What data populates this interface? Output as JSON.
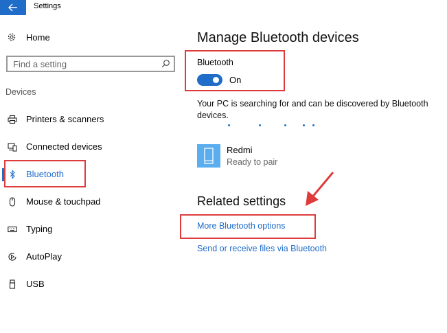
{
  "window": {
    "title": "Settings"
  },
  "sidebar": {
    "home_label": "Home",
    "search_placeholder": "Find a setting",
    "group_label": "Devices",
    "items": [
      {
        "label": "Printers & scanners",
        "icon": "printer-icon"
      },
      {
        "label": "Connected devices",
        "icon": "connected-devices-icon"
      },
      {
        "label": "Bluetooth",
        "icon": "bluetooth-icon",
        "selected": true
      },
      {
        "label": "Mouse & touchpad",
        "icon": "mouse-icon"
      },
      {
        "label": "Typing",
        "icon": "keyboard-icon"
      },
      {
        "label": "AutoPlay",
        "icon": "autoplay-icon"
      },
      {
        "label": "USB",
        "icon": "usb-icon"
      }
    ]
  },
  "main": {
    "title": "Manage Bluetooth devices",
    "bluetooth_label": "Bluetooth",
    "toggle_state": "On",
    "toggle_on": true,
    "status_text": "Your PC is searching for and can be discovered by Bluetooth devices.",
    "devices": [
      {
        "name": "Redmi",
        "status": "Ready to pair",
        "icon": "phone-icon"
      }
    ],
    "related_title": "Related settings",
    "related_links": [
      "More Bluetooth options",
      "Send or receive files via Bluetooth"
    ]
  },
  "colors": {
    "accent": "#1f6dc9",
    "highlight_box": "#de3c3c",
    "device_tile": "#5aaef0"
  }
}
